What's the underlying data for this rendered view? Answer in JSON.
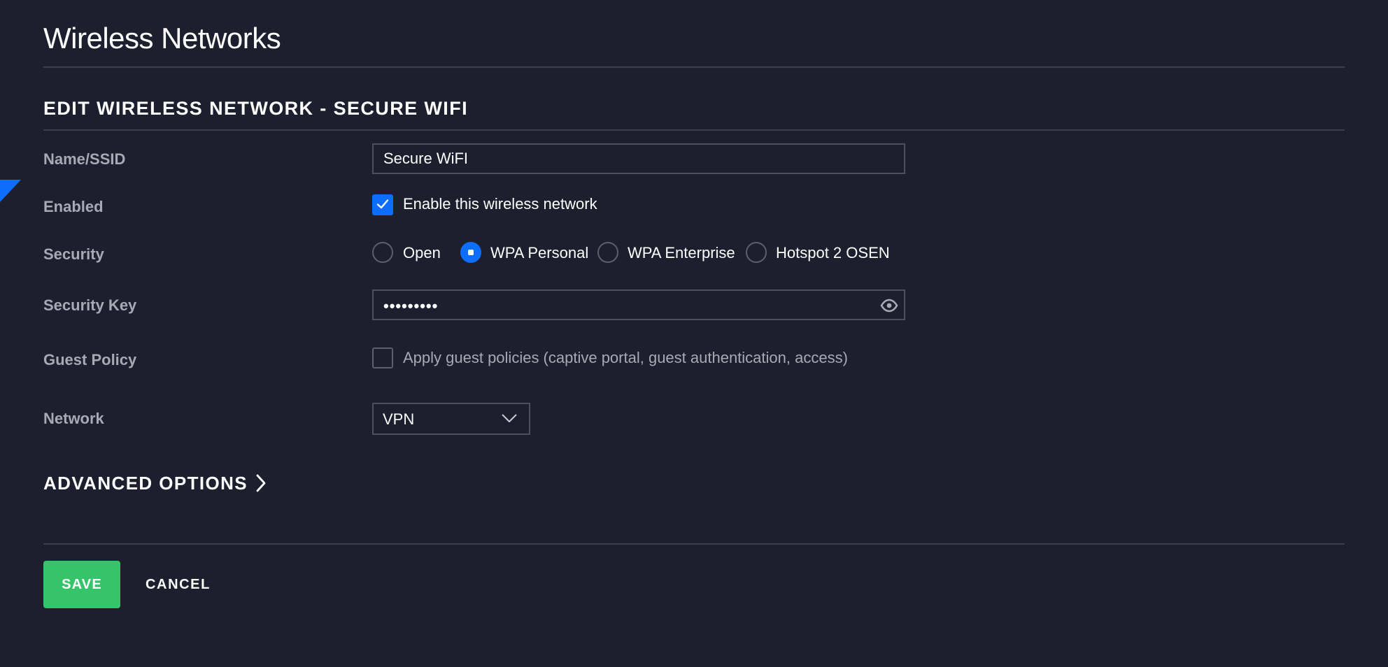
{
  "page": {
    "title": "Wireless Networks",
    "section_title": "EDIT WIRELESS NETWORK - SECURE WIFI"
  },
  "form": {
    "name": {
      "label": "Name/SSID",
      "value": "Secure WiFI"
    },
    "enabled": {
      "label": "Enabled",
      "checked": true,
      "option_label": "Enable this wireless network"
    },
    "security": {
      "label": "Security",
      "selected": "WPA Personal",
      "options": [
        {
          "label": "Open",
          "selected": false
        },
        {
          "label": "WPA Personal",
          "selected": true
        },
        {
          "label": "WPA Enterprise",
          "selected": false
        },
        {
          "label": "Hotspot 2 OSEN",
          "selected": false
        }
      ]
    },
    "security_key": {
      "label": "Security Key",
      "masked_value": "•••••••••",
      "reveal_icon": "eye-icon"
    },
    "guest_policy": {
      "label": "Guest Policy",
      "checked": false,
      "option_label": "Apply guest policies (captive portal, guest authentication, access)"
    },
    "network": {
      "label": "Network",
      "value": "VPN",
      "icon": "chevron-down-icon"
    }
  },
  "advanced": {
    "label": "ADVANCED OPTIONS",
    "icon": "chevron-right-icon"
  },
  "actions": {
    "save_label": "SAVE",
    "cancel_label": "CANCEL"
  },
  "colors": {
    "background": "#1d1f2e",
    "accent": "#0d6efd",
    "save_button": "#36c46a",
    "divider": "#3b3e4f",
    "label": "#a7aab4"
  }
}
